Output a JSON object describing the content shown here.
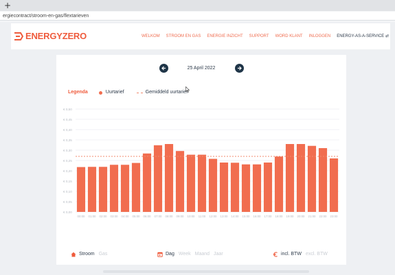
{
  "browser": {
    "new_tab": "+",
    "url": "ergiecontract/stroom-en-gas/flextarieven"
  },
  "header": {
    "logo_energy": "ENERGY",
    "logo_zero": "ZERO",
    "nav": [
      "WELKOM",
      "STROOM EN GAS",
      "ENERGIE INZICHT",
      "SUPPORT",
      "WORD KLANT",
      "INLOGGEN",
      "ENERGY-AS-A-SERVICE ⇄"
    ]
  },
  "datebar": {
    "date": "25 April 2022"
  },
  "legend": {
    "title": "Legenda",
    "hourly": "Uurtarief",
    "average": "Gemiddeld uurtarief"
  },
  "chart_data": {
    "type": "bar",
    "categories": [
      "00:00",
      "01:00",
      "02:00",
      "03:00",
      "04:00",
      "05:00",
      "06:00",
      "07:00",
      "08:00",
      "09:00",
      "10:00",
      "11:00",
      "12:00",
      "13:00",
      "14:00",
      "15:00",
      "16:00",
      "17:00",
      "18:00",
      "19:00",
      "20:00",
      "21:00",
      "22:00",
      "23:00"
    ],
    "values": [
      0.218,
      0.219,
      0.219,
      0.229,
      0.229,
      0.238,
      0.284,
      0.324,
      0.33,
      0.296,
      0.278,
      0.278,
      0.258,
      0.24,
      0.239,
      0.231,
      0.231,
      0.24,
      0.269,
      0.33,
      0.33,
      0.321,
      0.31,
      0.26
    ],
    "average": 0.27,
    "yticks": [
      "€ 0,50",
      "€ 0,45",
      "€ 0,40",
      "€ 0,35",
      "€ 0,30",
      "€ 0,25",
      "€ 0,20",
      "€ 0,15",
      "€ 0,10",
      "€ 0,05",
      "€ 0,00"
    ],
    "ylim": [
      0,
      0.5
    ],
    "grid": true,
    "bar_color": "#f16d4f",
    "average_color": "#f08a6c"
  },
  "footer": {
    "energy_selected": "Stroom",
    "energy_other": "Gas",
    "period_selected": "Dag",
    "period_options": [
      "Week",
      "Maand",
      "Jaar"
    ],
    "vat_selected": "incl. BTW",
    "vat_other": "excl. BTW"
  },
  "colors": {
    "brand": "#ef5b3c",
    "navy": "#1f3548"
  }
}
